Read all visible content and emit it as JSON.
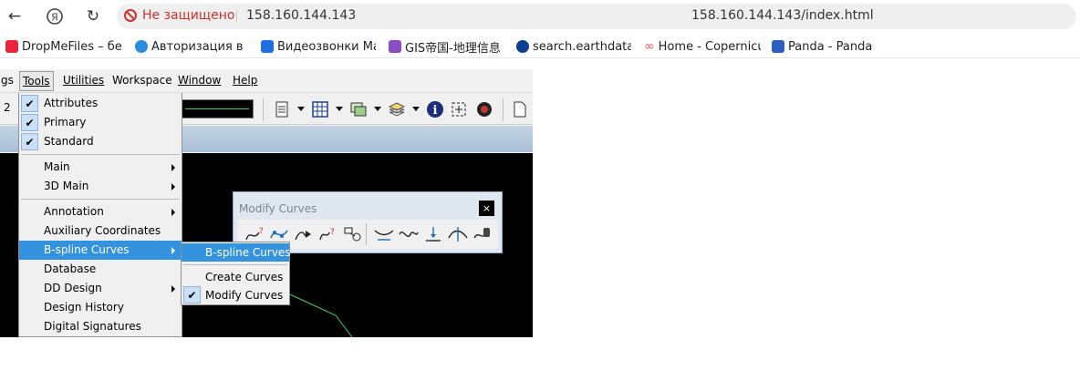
{
  "browser": {
    "secure_label": "Не защищено",
    "host": "158.160.144.143",
    "url": "158.160.144.143/index.html",
    "bookmarks": [
      {
        "label": "DropMeFiles – бес",
        "icon": "dropmefiles-icon",
        "color": "#e8253a"
      },
      {
        "label": "Авторизация в К",
        "icon": "leaf-icon",
        "color": "#2a8be0"
      },
      {
        "label": "Видеозвонки Mail",
        "icon": "video-icon",
        "color": "#1f6fe0"
      },
      {
        "label": "GIS帝国-地理信息",
        "icon": "gis-icon",
        "color": "#8b4cc4"
      },
      {
        "label": "search.earthdata.n",
        "icon": "nasa-icon",
        "color": "#0b3d91"
      },
      {
        "label": "Home - Copernicus",
        "icon": "copernicus-icon",
        "color": "#e05a74"
      },
      {
        "label": "Panda - Panda",
        "icon": "panda-icon",
        "color": "#2b5fbf"
      }
    ]
  },
  "menubar": {
    "items": [
      {
        "label": "gs"
      },
      {
        "label": "Tools"
      },
      {
        "label": "Utilities"
      },
      {
        "label": "Workspace"
      },
      {
        "label": "Window"
      },
      {
        "label": "Help"
      }
    ]
  },
  "toolbar": {
    "level_value": "2"
  },
  "tools_menu": {
    "items": [
      {
        "label": "Attributes",
        "checked": true
      },
      {
        "label": "Primary",
        "checked": true
      },
      {
        "label": "Standard",
        "checked": true
      },
      {
        "label": "Main",
        "submenu": true
      },
      {
        "label": "3D Main",
        "submenu": true
      },
      {
        "label": "Annotation",
        "submenu": true
      },
      {
        "label": "Auxiliary Coordinates"
      },
      {
        "label": "B-spline Curves",
        "submenu": true,
        "highlighted": true
      },
      {
        "label": "Database"
      },
      {
        "label": "DD Design",
        "submenu": true
      },
      {
        "label": "Design History"
      },
      {
        "label": "Digital Signatures"
      }
    ]
  },
  "submenu": {
    "items": [
      {
        "label": "B-spline Curves",
        "highlighted": true
      },
      {
        "label": "Create Curves"
      },
      {
        "label": "Modify Curves",
        "checked": true
      }
    ]
  },
  "palette": {
    "title": "Modify Curves",
    "close_label": "×"
  },
  "colors": {
    "highlight": "#3393df",
    "insecure": "#d3312c",
    "canvas": "#000000",
    "curve": "#3fd05a"
  }
}
